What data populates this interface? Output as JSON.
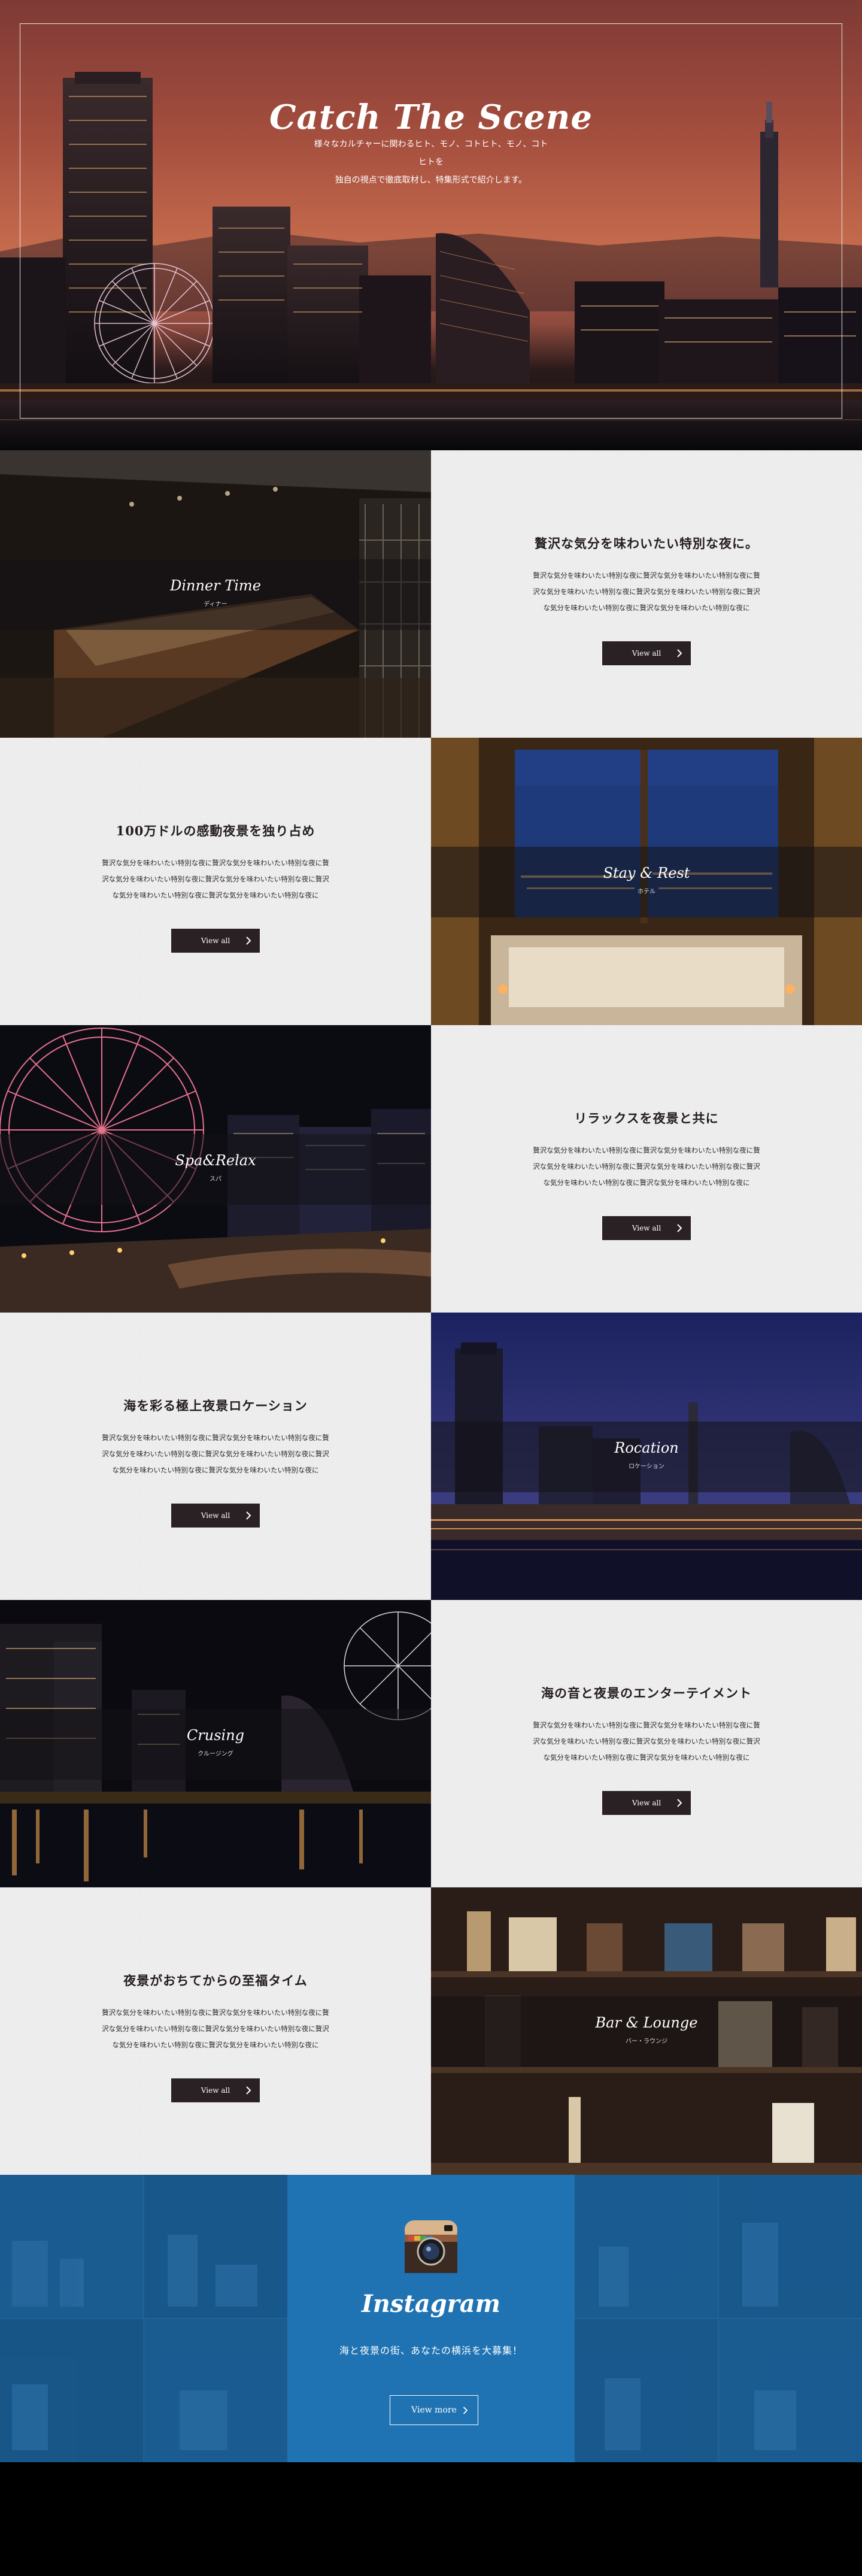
{
  "hero": {
    "title": "Catch The Scene",
    "subtitle_line1": "様々なカルチャーに関わるヒト、モノ、コトヒト、モノ、コトヒトを",
    "subtitle_line2": "独自の視点で徹底取材し、特集形式で紹介します。"
  },
  "sections": [
    {
      "layout": "image-left",
      "image_title": "Dinner Time",
      "image_subtitle": "ディナー",
      "heading": "贅沢な気分を味わいたい特別な夜に。",
      "body": "贅沢な気分を味わいたい特別な夜に贅沢な気分を味わいたい特別な夜に贅沢な気分を味わいたい特別な夜に贅沢な気分を味わいたい特別な夜に贅沢な気分を味わいたい特別な夜に贅沢な気分を味わいたい特別な夜に",
      "button": "View all"
    },
    {
      "layout": "image-right",
      "image_title": "Stay & Rest",
      "image_subtitle": "ホテル",
      "heading": "100万ドルの感動夜景を独り占め",
      "body": "贅沢な気分を味わいたい特別な夜に贅沢な気分を味わいたい特別な夜に贅沢な気分を味わいたい特別な夜に贅沢な気分を味わいたい特別な夜に贅沢な気分を味わいたい特別な夜に贅沢な気分を味わいたい特別な夜に",
      "button": "View all"
    },
    {
      "layout": "image-left",
      "image_title": "Spa&Relax",
      "image_subtitle": "スパ",
      "heading": "リラックスを夜景と共に",
      "body": "贅沢な気分を味わいたい特別な夜に贅沢な気分を味わいたい特別な夜に贅沢な気分を味わいたい特別な夜に贅沢な気分を味わいたい特別な夜に贅沢な気分を味わいたい特別な夜に贅沢な気分を味わいたい特別な夜に",
      "button": "View all"
    },
    {
      "layout": "image-right",
      "image_title": "Rocation",
      "image_subtitle": "ロケーション",
      "heading": "海を彩る極上夜景ロケーション",
      "body": "贅沢な気分を味わいたい特別な夜に贅沢な気分を味わいたい特別な夜に贅沢な気分を味わいたい特別な夜に贅沢な気分を味わいたい特別な夜に贅沢な気分を味わいたい特別な夜に贅沢な気分を味わいたい特別な夜に",
      "button": "View all"
    },
    {
      "layout": "image-left",
      "image_title": "Crusing",
      "image_subtitle": "クルージング",
      "heading": "海の音と夜景のエンターテイメント",
      "body": "贅沢な気分を味わいたい特別な夜に贅沢な気分を味わいたい特別な夜に贅沢な気分を味わいたい特別な夜に贅沢な気分を味わいたい特別な夜に贅沢な気分を味わいたい特別な夜に贅沢な気分を味わいたい特別な夜に",
      "button": "View all"
    },
    {
      "layout": "image-right",
      "image_title": "Bar & Lounge",
      "image_subtitle": "バー・ラウンジ",
      "heading": "夜景がおちてからの至福タイム",
      "body": "贅沢な気分を味わいたい特別な夜に贅沢な気分を味わいたい特別な夜に贅沢な気分を味わいたい特別な夜に贅沢な気分を味わいたい特別な夜に贅沢な気分を味わいたい特別な夜に贅沢な気分を味わいたい特別な夜に",
      "button": "View all"
    }
  ],
  "instagram": {
    "icon": "instagram-camera-icon",
    "name": "Instagram",
    "text": "海と夜景の街、あなたの横浜を大募集！",
    "button": "View more"
  },
  "colors": {
    "button_bg": "#2a2125",
    "panel_bg": "#efeeee",
    "instagram_blue": "#1f73b3"
  }
}
